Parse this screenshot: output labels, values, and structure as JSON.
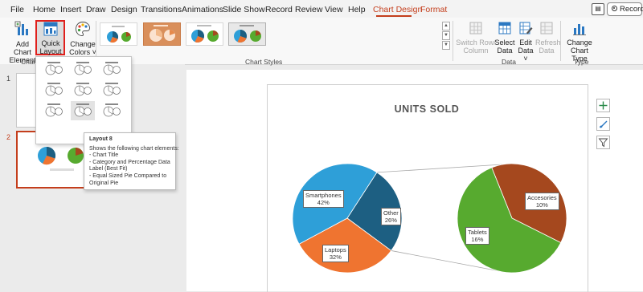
{
  "menu": {
    "tabs": [
      {
        "label": "File"
      },
      {
        "label": "Home"
      },
      {
        "label": "Insert"
      },
      {
        "label": "Draw"
      },
      {
        "label": "Design"
      },
      {
        "label": "Transitions"
      },
      {
        "label": "Animations"
      },
      {
        "label": "Slide Show"
      },
      {
        "label": "Record"
      },
      {
        "label": "Review"
      },
      {
        "label": "View"
      },
      {
        "label": "Help"
      },
      {
        "label": "Chart Design"
      },
      {
        "label": "Format"
      }
    ],
    "active_tab": "Chart Design",
    "record_label": "Record",
    "accent_color": "#c43e1c"
  },
  "ribbon": {
    "add_chart_element": [
      "Add Chart",
      "Element ˅"
    ],
    "quick_layout": [
      "Quick",
      "Layout ˅"
    ],
    "change_colors": [
      "Change",
      "Colors ˅"
    ],
    "group_chart_layouts": "Chart La",
    "group_chart_styles": "Chart Styles",
    "switch_row_column": [
      "Switch Row/",
      "Column"
    ],
    "select_data": [
      "Select",
      "Data"
    ],
    "edit_data": [
      "Edit",
      "Data ˅"
    ],
    "refresh_data": [
      "Refresh",
      "Data"
    ],
    "group_data": "Data",
    "change_chart_type": [
      "Change",
      "Chart Type"
    ],
    "group_type": "Type"
  },
  "slides": {
    "numbers": [
      "1",
      "2"
    ],
    "active": "2"
  },
  "quick_layout_tooltip": {
    "title": "Layout 8",
    "lines": [
      "Shows the following chart elements:",
      "- Chart Title",
      "- Category and Percentage Data",
      "Label (Best Fit)",
      "- Equal Sized Pie Compared to",
      "Original Pie"
    ]
  },
  "chart": {
    "title": "UNITS SOLD"
  },
  "chart_data": {
    "type": "pie",
    "subtype": "pie-of-pie",
    "title": "UNITS SOLD",
    "primary_pie": [
      {
        "category": "Smartphones",
        "value": 42,
        "label": "Smartphones\n42%",
        "color": "#2e9fd8"
      },
      {
        "category": "Other",
        "value": 26,
        "label": "Other\n26%",
        "color": "#1d5f82"
      },
      {
        "category": "Laptops",
        "value": 32,
        "label": "Laptops\n32%",
        "color": "#ef7430"
      }
    ],
    "secondary_pie": [
      {
        "category": "Tablets",
        "value": 16,
        "label": "Tablets\n16%",
        "color": "#57aa2f"
      },
      {
        "category": "Accesories",
        "value": 10,
        "label": "Accesories\n10%",
        "color": "#a5481e"
      }
    ]
  },
  "icons": {
    "add": "plus-icon",
    "style": "brush-icon",
    "filter": "filter-icon"
  }
}
